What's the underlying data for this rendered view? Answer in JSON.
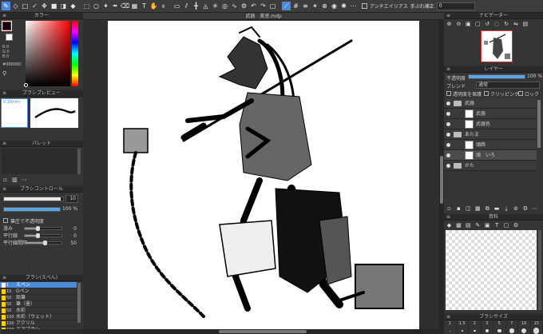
{
  "toolbar": {
    "antialias_label": "アンチエイリアス",
    "correction_label": "手ぶれ補正",
    "correction_value": "0"
  },
  "document": {
    "tab_title": "武器　美兎.mdp"
  },
  "color_panel": {
    "title": "カラー",
    "hex_value": "#000000",
    "rgb": [
      "R:0",
      "G:0",
      "B:0"
    ],
    "foreground": "#000000",
    "background": "#ffffff"
  },
  "brush_preview": {
    "title": "ブラシプレビュー",
    "size": "0.16mm"
  },
  "palette": {
    "title": "パレット"
  },
  "brush_control": {
    "title": "ブラシコントロール",
    "size_value": "10",
    "opacity_value": "100 %",
    "minimum_opacity_label": "筆圧で不透明度",
    "params": [
      {
        "label": "滑み",
        "value": "0",
        "level": 0.35
      },
      {
        "label": "平行線",
        "value": "0",
        "level": 0.35
      },
      {
        "label": "平行線間隔",
        "value": "50",
        "level": 0.55
      }
    ]
  },
  "brush_list": {
    "title": "ブラシ(えぺん)",
    "items": [
      {
        "size": "1",
        "name": "えペン",
        "color": "#ffffff",
        "selected": true
      },
      {
        "size": "10",
        "name": "Gペン",
        "color": "#ffd000",
        "selected": false
      },
      {
        "size": "50",
        "name": "鉛筆",
        "color": "#ffd000",
        "selected": false
      },
      {
        "size": "50",
        "name": "筆（墨）",
        "color": "#ffd000",
        "selected": false
      },
      {
        "size": "50",
        "name": "水彩",
        "color": "#ffd000",
        "selected": false
      },
      {
        "size": "100",
        "name": "水彩（ウェット）",
        "color": "#ffd000",
        "selected": false
      },
      {
        "size": "100",
        "name": "アクリル",
        "color": "#ffd000",
        "selected": false
      },
      {
        "size": "100",
        "name": "エアブラシ",
        "color": "#ffd000",
        "selected": false
      }
    ]
  },
  "navigator": {
    "title": "ナビゲーター"
  },
  "layers": {
    "title": "レイヤー",
    "opacity_label": "不透明度",
    "opacity_value": "100 %",
    "blend_label": "ブレンド",
    "blend_value": "通常",
    "protect_label": "透明度を保護",
    "clipping_label": "クリッピング",
    "lock_label": "ロック",
    "items": [
      {
        "name": "武器",
        "type": "folder",
        "indent": 0,
        "selected": false
      },
      {
        "name": "武器",
        "type": "layer",
        "indent": 1,
        "selected": false
      },
      {
        "name": "武器色",
        "type": "layer",
        "indent": 1,
        "selected": false
      },
      {
        "name": "あたま",
        "type": "folder",
        "indent": 0,
        "selected": false
      },
      {
        "name": "頭飾",
        "type": "layer",
        "indent": 1,
        "selected": false
      },
      {
        "name": "頭　いろ",
        "type": "layer",
        "indent": 1,
        "selected": true
      },
      {
        "name": "かた",
        "type": "folder",
        "indent": 0,
        "selected": false
      }
    ]
  },
  "materials": {
    "title": "資料"
  },
  "brush_size": {
    "title": "ブラシサイズ",
    "sizes": [
      "1",
      "1.5",
      "2",
      "3",
      "5",
      "7",
      "10",
      "15"
    ]
  },
  "colors": {
    "accent": "#4a8ad9",
    "panel": "#353535",
    "toolbar": "#3c3c3c"
  }
}
